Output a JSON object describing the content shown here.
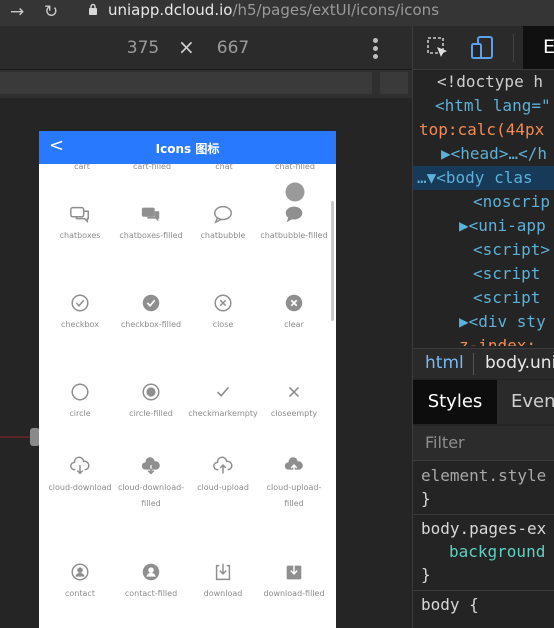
{
  "browser": {
    "url_host": "uniapp.dcloud.io",
    "url_path": "/h5/pages/extUI/icons/icons"
  },
  "device_toolbar": {
    "width": "375",
    "height": "667",
    "separator": "×"
  },
  "app": {
    "back_label": "<",
    "title": "Icons 图标",
    "top_row": [
      "cart",
      "cart-filled",
      "chat",
      "chat-filled"
    ],
    "icons": [
      {
        "label": "chatboxes",
        "icon": "chatboxes-icon"
      },
      {
        "label": "chatboxes-filled",
        "icon": "chatboxes-filled-icon"
      },
      {
        "label": "chatbubble",
        "icon": "chatbubble-icon"
      },
      {
        "label": "chatbubble-filled",
        "icon": "chatbubble-filled-icon"
      },
      {
        "label": "checkbox",
        "icon": "checkbox-icon"
      },
      {
        "label": "checkbox-filled",
        "icon": "checkbox-filled-icon"
      },
      {
        "label": "close",
        "icon": "close-icon"
      },
      {
        "label": "clear",
        "icon": "clear-icon"
      },
      {
        "label": "circle",
        "icon": "circle-icon"
      },
      {
        "label": "circle-filled",
        "icon": "circle-filled-icon"
      },
      {
        "label": "checkmarkempty",
        "icon": "checkmarkempty-icon"
      },
      {
        "label": "closeempty",
        "icon": "closeempty-icon"
      },
      {
        "label": "cloud-download",
        "icon": "cloud-download-icon"
      },
      {
        "label": "cloud-download-filled",
        "icon": "cloud-download-filled-icon"
      },
      {
        "label": "cloud-upload",
        "icon": "cloud-upload-icon"
      },
      {
        "label": "cloud-upload-filled",
        "icon": "cloud-upload-filled-icon"
      },
      {
        "label": "contact",
        "icon": "contact-icon"
      },
      {
        "label": "contact-filled",
        "icon": "contact-filled-icon"
      },
      {
        "label": "download",
        "icon": "download-icon"
      },
      {
        "label": "download-filled",
        "icon": "download-filled-icon"
      }
    ]
  },
  "devtools": {
    "tab_active": "E",
    "code_lines": [
      {
        "text": "<!doctype h"
      },
      {
        "text": "<html lang=\""
      },
      {
        "text": "top:calc(44px"
      },
      {
        "text": "▶<head>…</h"
      },
      {
        "text": "…▼<body clas"
      },
      {
        "text": "<noscrip"
      },
      {
        "text": "▶<uni-app"
      },
      {
        "text": "<script>"
      },
      {
        "text": "<script "
      },
      {
        "text": "<script "
      },
      {
        "text": "▶<div sty"
      },
      {
        "text": "z-index:"
      }
    ],
    "breadcrumbs": [
      "html",
      "body.uni"
    ],
    "style_tabs": [
      "Styles",
      "Even"
    ],
    "filter_placeholder": "Filter",
    "rules": [
      {
        "selector": "element.style",
        "close": "}"
      },
      {
        "selector": "body.pages-ex",
        "prop": "background",
        "close": "}"
      },
      {
        "selector": "body {"
      }
    ]
  },
  "colors": {
    "header_blue": "#2979ff",
    "icon_gray": "#8f8f8f",
    "devtools_selection": "#173a59"
  }
}
